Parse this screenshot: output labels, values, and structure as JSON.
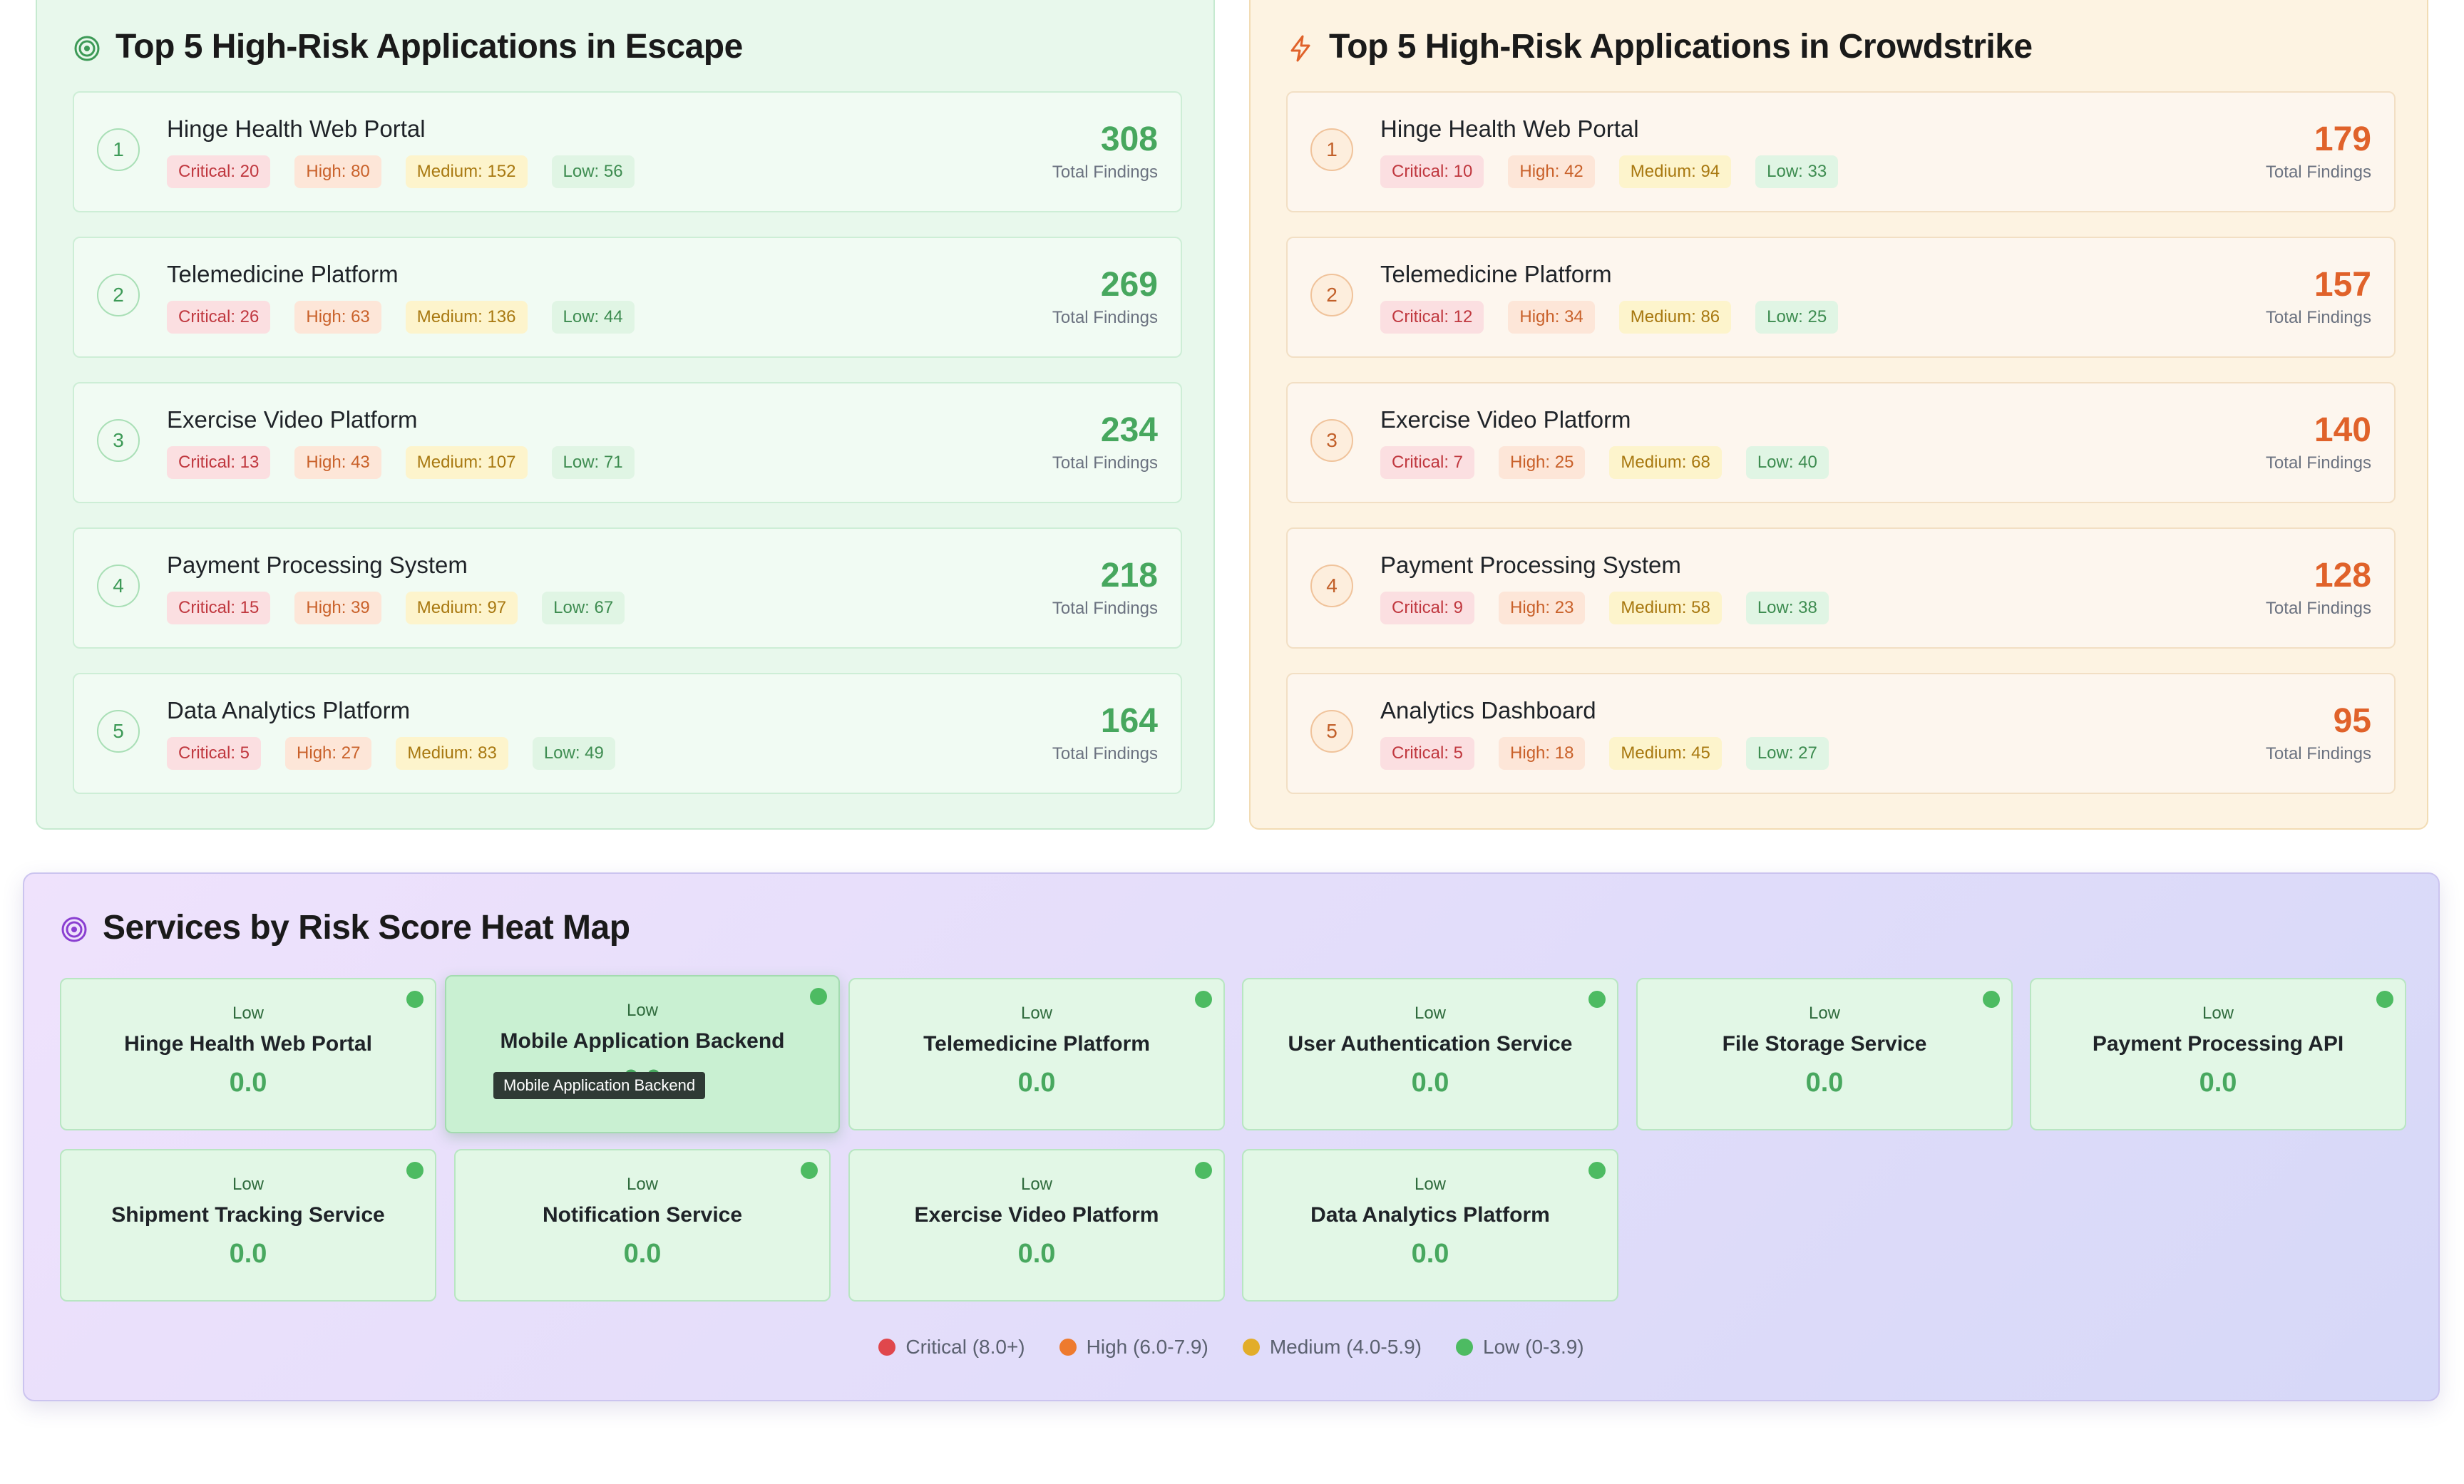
{
  "escape": {
    "title": "Top 5 High-Risk Applications in Escape",
    "icon": "target-icon",
    "apps": [
      {
        "rank": "1",
        "name": "Hinge Health Web Portal",
        "critical": "Critical: 20",
        "high": "High: 80",
        "medium": "Medium: 152",
        "low": "Low: 56",
        "total": "308",
        "total_label": "Total Findings"
      },
      {
        "rank": "2",
        "name": "Telemedicine Platform",
        "critical": "Critical: 26",
        "high": "High: 63",
        "medium": "Medium: 136",
        "low": "Low: 44",
        "total": "269",
        "total_label": "Total Findings"
      },
      {
        "rank": "3",
        "name": "Exercise Video Platform",
        "critical": "Critical: 13",
        "high": "High: 43",
        "medium": "Medium: 107",
        "low": "Low: 71",
        "total": "234",
        "total_label": "Total Findings"
      },
      {
        "rank": "4",
        "name": "Payment Processing System",
        "critical": "Critical: 15",
        "high": "High: 39",
        "medium": "Medium: 97",
        "low": "Low: 67",
        "total": "218",
        "total_label": "Total Findings"
      },
      {
        "rank": "5",
        "name": "Data Analytics Platform",
        "critical": "Critical: 5",
        "high": "High: 27",
        "medium": "Medium: 83",
        "low": "Low: 49",
        "total": "164",
        "total_label": "Total Findings"
      }
    ]
  },
  "crowdstrike": {
    "title": "Top 5 High-Risk Applications in Crowdstrike",
    "icon": "lightning-icon",
    "apps": [
      {
        "rank": "1",
        "name": "Hinge Health Web Portal",
        "critical": "Critical: 10",
        "high": "High: 42",
        "medium": "Medium: 94",
        "low": "Low: 33",
        "total": "179",
        "total_label": "Total Findings"
      },
      {
        "rank": "2",
        "name": "Telemedicine Platform",
        "critical": "Critical: 12",
        "high": "High: 34",
        "medium": "Medium: 86",
        "low": "Low: 25",
        "total": "157",
        "total_label": "Total Findings"
      },
      {
        "rank": "3",
        "name": "Exercise Video Platform",
        "critical": "Critical: 7",
        "high": "High: 25",
        "medium": "Medium: 68",
        "low": "Low: 40",
        "total": "140",
        "total_label": "Total Findings"
      },
      {
        "rank": "4",
        "name": "Payment Processing System",
        "critical": "Critical: 9",
        "high": "High: 23",
        "medium": "Medium: 58",
        "low": "Low: 38",
        "total": "128",
        "total_label": "Total Findings"
      },
      {
        "rank": "5",
        "name": "Analytics Dashboard",
        "critical": "Critical: 5",
        "high": "High: 18",
        "medium": "Medium: 45",
        "low": "Low: 27",
        "total": "95",
        "total_label": "Total Findings"
      }
    ]
  },
  "heatmap": {
    "title": "Services by Risk Score Heat Map",
    "icon": "target-icon",
    "tiles": [
      {
        "level": "Low",
        "name": "Hinge Health Web Portal",
        "score": "0.0"
      },
      {
        "level": "Low",
        "name": "Mobile Application Backend",
        "score": "0.0"
      },
      {
        "level": "Low",
        "name": "Telemedicine Platform",
        "score": "0.0"
      },
      {
        "level": "Low",
        "name": "User Authentication Service",
        "score": "0.0"
      },
      {
        "level": "Low",
        "name": "File Storage Service",
        "score": "0.0"
      },
      {
        "level": "Low",
        "name": "Payment Processing API",
        "score": "0.0"
      },
      {
        "level": "Low",
        "name": "Shipment Tracking Service",
        "score": "0.0"
      },
      {
        "level": "Low",
        "name": "Notification Service",
        "score": "0.0"
      },
      {
        "level": "Low",
        "name": "Exercise Video Platform",
        "score": "0.0"
      },
      {
        "level": "Low",
        "name": "Data Analytics Platform",
        "score": "0.0"
      }
    ],
    "tooltip": "Mobile Application Backend",
    "legend": [
      {
        "label": "Critical (8.0+)",
        "color": "#e0474c"
      },
      {
        "label": "High (6.0-7.9)",
        "color": "#ee7a2e"
      },
      {
        "label": "Medium (4.0-5.9)",
        "color": "#e2ad2a"
      },
      {
        "label": "Low (0-3.9)",
        "color": "#4dbb62"
      }
    ]
  }
}
